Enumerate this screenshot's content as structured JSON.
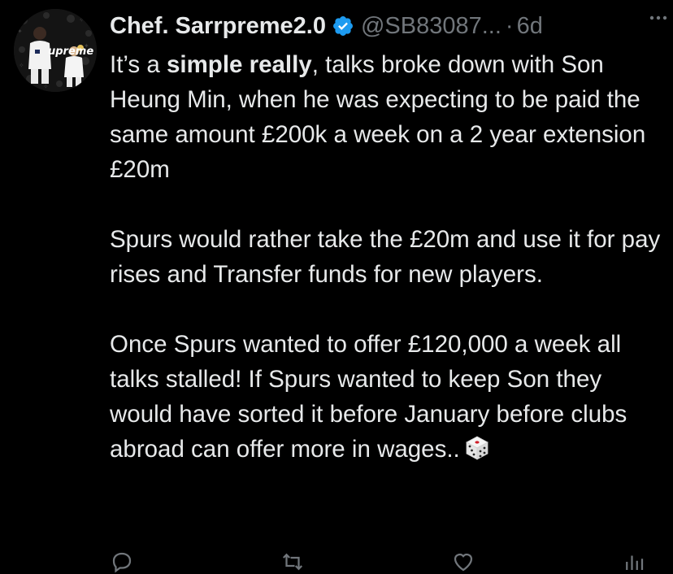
{
  "tweet": {
    "author": {
      "display_name": "Chef. Sarrpreme2.0",
      "handle": "@SB83087...",
      "separator": "·",
      "time_ago": "6d",
      "avatar_text": "upreme",
      "verified_icon": "verified-badge-icon"
    },
    "more_icon": "more-options-icon",
    "paragraphs": [
      {
        "intro": "It’s a ",
        "bold": "simple really",
        "text": ", talks broke down with Son Heung Min, when he was expecting to be paid the same amount £200k a week on a 2 year extension £20m"
      },
      {
        "text": "Spurs would rather take the £20m and use it for pay rises and Transfer funds for new players."
      },
      {
        "text": "Once Spurs wanted to offer £120,000 a week all talks stalled! If Spurs wanted to keep Son they would have sorted it before January before clubs abroad can offer more in wages.."
      }
    ],
    "emoji_icon": "game-die-icon",
    "actions": [
      "reply-icon",
      "retweet-icon",
      "like-icon",
      "views-icon"
    ]
  },
  "colors": {
    "background": "#000000",
    "text_primary": "#e7e9ea",
    "text_secondary": "#71767b",
    "verified": "#1d9bf0"
  }
}
